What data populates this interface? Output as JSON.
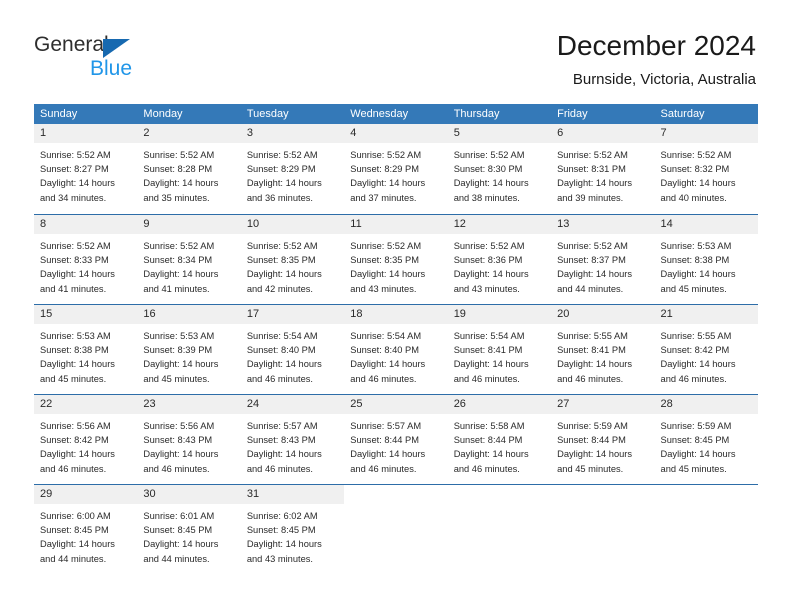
{
  "brand": {
    "name_part1": "General",
    "name_part2": "Blue",
    "triangle_color": "#1769b0",
    "blue_text_color": "#2196e8"
  },
  "header": {
    "title": "December 2024",
    "subtitle": "Burnside, Victoria, Australia"
  },
  "theme": {
    "header_row_bg": "#3479b8",
    "row_divider": "#2d6da8",
    "daynum_bg": "#f0f0f0",
    "text": "#2a2a2a"
  },
  "weekdays": [
    "Sunday",
    "Monday",
    "Tuesday",
    "Wednesday",
    "Thursday",
    "Friday",
    "Saturday"
  ],
  "weeks": [
    [
      {
        "day": "1",
        "sunrise": "Sunrise: 5:52 AM",
        "sunset": "Sunset: 8:27 PM",
        "daylight": "Daylight: 14 hours and 34 minutes."
      },
      {
        "day": "2",
        "sunrise": "Sunrise: 5:52 AM",
        "sunset": "Sunset: 8:28 PM",
        "daylight": "Daylight: 14 hours and 35 minutes."
      },
      {
        "day": "3",
        "sunrise": "Sunrise: 5:52 AM",
        "sunset": "Sunset: 8:29 PM",
        "daylight": "Daylight: 14 hours and 36 minutes."
      },
      {
        "day": "4",
        "sunrise": "Sunrise: 5:52 AM",
        "sunset": "Sunset: 8:29 PM",
        "daylight": "Daylight: 14 hours and 37 minutes."
      },
      {
        "day": "5",
        "sunrise": "Sunrise: 5:52 AM",
        "sunset": "Sunset: 8:30 PM",
        "daylight": "Daylight: 14 hours and 38 minutes."
      },
      {
        "day": "6",
        "sunrise": "Sunrise: 5:52 AM",
        "sunset": "Sunset: 8:31 PM",
        "daylight": "Daylight: 14 hours and 39 minutes."
      },
      {
        "day": "7",
        "sunrise": "Sunrise: 5:52 AM",
        "sunset": "Sunset: 8:32 PM",
        "daylight": "Daylight: 14 hours and 40 minutes."
      }
    ],
    [
      {
        "day": "8",
        "sunrise": "Sunrise: 5:52 AM",
        "sunset": "Sunset: 8:33 PM",
        "daylight": "Daylight: 14 hours and 41 minutes."
      },
      {
        "day": "9",
        "sunrise": "Sunrise: 5:52 AM",
        "sunset": "Sunset: 8:34 PM",
        "daylight": "Daylight: 14 hours and 41 minutes."
      },
      {
        "day": "10",
        "sunrise": "Sunrise: 5:52 AM",
        "sunset": "Sunset: 8:35 PM",
        "daylight": "Daylight: 14 hours and 42 minutes."
      },
      {
        "day": "11",
        "sunrise": "Sunrise: 5:52 AM",
        "sunset": "Sunset: 8:35 PM",
        "daylight": "Daylight: 14 hours and 43 minutes."
      },
      {
        "day": "12",
        "sunrise": "Sunrise: 5:52 AM",
        "sunset": "Sunset: 8:36 PM",
        "daylight": "Daylight: 14 hours and 43 minutes."
      },
      {
        "day": "13",
        "sunrise": "Sunrise: 5:52 AM",
        "sunset": "Sunset: 8:37 PM",
        "daylight": "Daylight: 14 hours and 44 minutes."
      },
      {
        "day": "14",
        "sunrise": "Sunrise: 5:53 AM",
        "sunset": "Sunset: 8:38 PM",
        "daylight": "Daylight: 14 hours and 45 minutes."
      }
    ],
    [
      {
        "day": "15",
        "sunrise": "Sunrise: 5:53 AM",
        "sunset": "Sunset: 8:38 PM",
        "daylight": "Daylight: 14 hours and 45 minutes."
      },
      {
        "day": "16",
        "sunrise": "Sunrise: 5:53 AM",
        "sunset": "Sunset: 8:39 PM",
        "daylight": "Daylight: 14 hours and 45 minutes."
      },
      {
        "day": "17",
        "sunrise": "Sunrise: 5:54 AM",
        "sunset": "Sunset: 8:40 PM",
        "daylight": "Daylight: 14 hours and 46 minutes."
      },
      {
        "day": "18",
        "sunrise": "Sunrise: 5:54 AM",
        "sunset": "Sunset: 8:40 PM",
        "daylight": "Daylight: 14 hours and 46 minutes."
      },
      {
        "day": "19",
        "sunrise": "Sunrise: 5:54 AM",
        "sunset": "Sunset: 8:41 PM",
        "daylight": "Daylight: 14 hours and 46 minutes."
      },
      {
        "day": "20",
        "sunrise": "Sunrise: 5:55 AM",
        "sunset": "Sunset: 8:41 PM",
        "daylight": "Daylight: 14 hours and 46 minutes."
      },
      {
        "day": "21",
        "sunrise": "Sunrise: 5:55 AM",
        "sunset": "Sunset: 8:42 PM",
        "daylight": "Daylight: 14 hours and 46 minutes."
      }
    ],
    [
      {
        "day": "22",
        "sunrise": "Sunrise: 5:56 AM",
        "sunset": "Sunset: 8:42 PM",
        "daylight": "Daylight: 14 hours and 46 minutes."
      },
      {
        "day": "23",
        "sunrise": "Sunrise: 5:56 AM",
        "sunset": "Sunset: 8:43 PM",
        "daylight": "Daylight: 14 hours and 46 minutes."
      },
      {
        "day": "24",
        "sunrise": "Sunrise: 5:57 AM",
        "sunset": "Sunset: 8:43 PM",
        "daylight": "Daylight: 14 hours and 46 minutes."
      },
      {
        "day": "25",
        "sunrise": "Sunrise: 5:57 AM",
        "sunset": "Sunset: 8:44 PM",
        "daylight": "Daylight: 14 hours and 46 minutes."
      },
      {
        "day": "26",
        "sunrise": "Sunrise: 5:58 AM",
        "sunset": "Sunset: 8:44 PM",
        "daylight": "Daylight: 14 hours and 46 minutes."
      },
      {
        "day": "27",
        "sunrise": "Sunrise: 5:59 AM",
        "sunset": "Sunset: 8:44 PM",
        "daylight": "Daylight: 14 hours and 45 minutes."
      },
      {
        "day": "28",
        "sunrise": "Sunrise: 5:59 AM",
        "sunset": "Sunset: 8:45 PM",
        "daylight": "Daylight: 14 hours and 45 minutes."
      }
    ],
    [
      {
        "day": "29",
        "sunrise": "Sunrise: 6:00 AM",
        "sunset": "Sunset: 8:45 PM",
        "daylight": "Daylight: 14 hours and 44 minutes."
      },
      {
        "day": "30",
        "sunrise": "Sunrise: 6:01 AM",
        "sunset": "Sunset: 8:45 PM",
        "daylight": "Daylight: 14 hours and 44 minutes."
      },
      {
        "day": "31",
        "sunrise": "Sunrise: 6:02 AM",
        "sunset": "Sunset: 8:45 PM",
        "daylight": "Daylight: 14 hours and 43 minutes."
      },
      {
        "day": "",
        "sunrise": "",
        "sunset": "",
        "daylight": ""
      },
      {
        "day": "",
        "sunrise": "",
        "sunset": "",
        "daylight": ""
      },
      {
        "day": "",
        "sunrise": "",
        "sunset": "",
        "daylight": ""
      },
      {
        "day": "",
        "sunrise": "",
        "sunset": "",
        "daylight": ""
      }
    ]
  ]
}
